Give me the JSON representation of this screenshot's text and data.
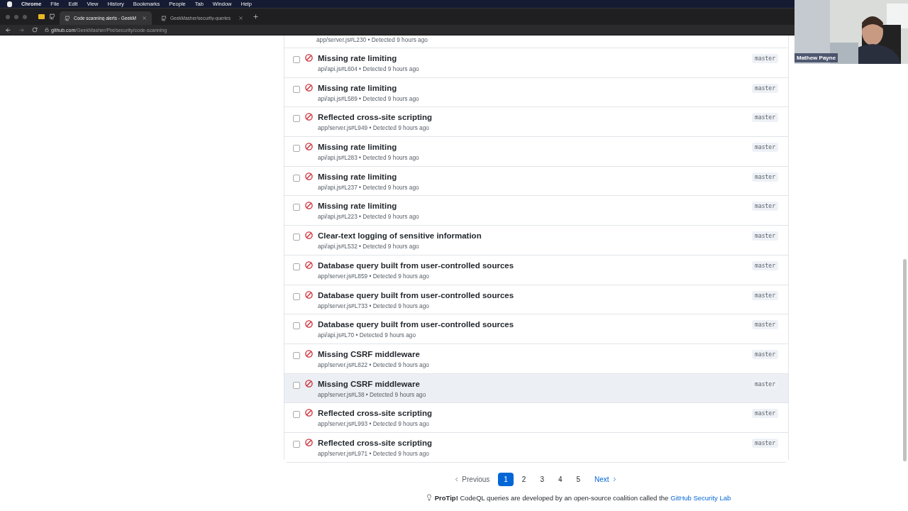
{
  "menubar": {
    "items": [
      {
        "label": "Chrome",
        "bold": true
      },
      {
        "label": "File",
        "bold": false
      },
      {
        "label": "Edit",
        "bold": false
      },
      {
        "label": "View",
        "bold": false
      },
      {
        "label": "History",
        "bold": false
      },
      {
        "label": "Bookmarks",
        "bold": false
      },
      {
        "label": "People",
        "bold": false
      },
      {
        "label": "Tab",
        "bold": false
      },
      {
        "label": "Window",
        "bold": false
      },
      {
        "label": "Help",
        "bold": false
      }
    ]
  },
  "tabs": [
    {
      "title": "Code scanning alerts - GeekM",
      "selected": true
    },
    {
      "title": "GeekMasher/security-queries",
      "selected": false
    }
  ],
  "address": {
    "host": "github.com",
    "path": "/GeekMasher/Pixi/security/code-scanning"
  },
  "partial_row": {
    "meta": "app/server.js#L230 • Detected 9 hours ago"
  },
  "alerts": [
    {
      "title": "Missing rate limiting",
      "meta": "api/api.js#L604 • Detected 9 hours ago",
      "branch": "master",
      "checked": false,
      "hovered": false
    },
    {
      "title": "Missing rate limiting",
      "meta": "api/api.js#L589 • Detected 9 hours ago",
      "branch": "master",
      "checked": false,
      "hovered": false
    },
    {
      "title": "Reflected cross-site scripting",
      "meta": "app/server.js#L949 • Detected 9 hours ago",
      "branch": "master",
      "checked": false,
      "hovered": false
    },
    {
      "title": "Missing rate limiting",
      "meta": "api/api.js#L283 • Detected 9 hours ago",
      "branch": "master",
      "checked": false,
      "hovered": false
    },
    {
      "title": "Missing rate limiting",
      "meta": "api/api.js#L237 • Detected 9 hours ago",
      "branch": "master",
      "checked": false,
      "hovered": false
    },
    {
      "title": "Missing rate limiting",
      "meta": "api/api.js#L223 • Detected 9 hours ago",
      "branch": "master",
      "checked": false,
      "hovered": false
    },
    {
      "title": "Clear-text logging of sensitive information",
      "meta": "api/api.js#L532 • Detected 9 hours ago",
      "branch": "master",
      "checked": false,
      "hovered": false
    },
    {
      "title": "Database query built from user-controlled sources",
      "meta": "app/server.js#L859 • Detected 9 hours ago",
      "branch": "master",
      "checked": false,
      "hovered": false
    },
    {
      "title": "Database query built from user-controlled sources",
      "meta": "app/server.js#L733 • Detected 9 hours ago",
      "branch": "master",
      "checked": false,
      "hovered": false
    },
    {
      "title": "Database query built from user-controlled sources",
      "meta": "api/api.js#L70 • Detected 9 hours ago",
      "branch": "master",
      "checked": false,
      "hovered": false
    },
    {
      "title": "Missing CSRF middleware",
      "meta": "app/server.js#L822 • Detected 9 hours ago",
      "branch": "master",
      "checked": false,
      "hovered": false
    },
    {
      "title": "Missing CSRF middleware",
      "meta": "app/server.js#L38 • Detected 9 hours ago",
      "branch": "master",
      "checked": false,
      "hovered": true
    },
    {
      "title": "Reflected cross-site scripting",
      "meta": "app/server.js#L993 • Detected 9 hours ago",
      "branch": "master",
      "checked": false,
      "hovered": false
    },
    {
      "title": "Reflected cross-site scripting",
      "meta": "app/server.js#L971 • Detected 9 hours ago",
      "branch": "master",
      "checked": false,
      "hovered": false
    }
  ],
  "pagination": {
    "previous": "Previous",
    "next": "Next",
    "pages": [
      {
        "label": "1",
        "selected": true
      },
      {
        "label": "2",
        "selected": false
      },
      {
        "label": "3",
        "selected": false
      },
      {
        "label": "4",
        "selected": false
      },
      {
        "label": "5",
        "selected": false
      }
    ]
  },
  "protip": {
    "text": "**ProTip!** CodeQL queries are developed by an open-source coalition called the",
    "link": "GitHub Security Lab"
  },
  "webcam": {
    "kind": "picture",
    "name": "Mathew Payne"
  }
}
